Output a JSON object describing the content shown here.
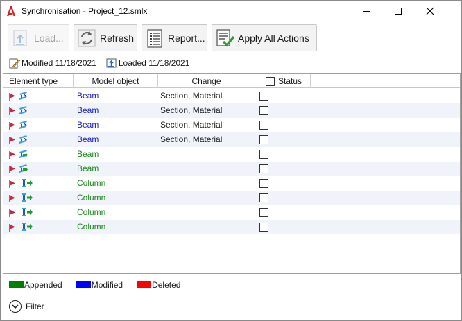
{
  "window": {
    "title": "Synchronisation - Project_12.smlx"
  },
  "toolbar": {
    "load_label": "Load...",
    "refresh_label": "Refresh",
    "report_label": "Report...",
    "apply_label": "Apply All Actions"
  },
  "info": {
    "modified": "Modified 11/18/2021",
    "loaded": "Loaded 11/18/2021"
  },
  "table": {
    "columns": [
      "Element type",
      "Model object",
      "Change",
      "Status"
    ],
    "rows": [
      {
        "element_icon": "beam-modified-icon",
        "object": "Beam",
        "change": "Section, Material",
        "status": false,
        "state": "modified"
      },
      {
        "element_icon": "beam-modified-icon",
        "object": "Beam",
        "change": "Section, Material",
        "status": false,
        "state": "modified"
      },
      {
        "element_icon": "beam-modified-icon",
        "object": "Beam",
        "change": "Section, Material",
        "status": false,
        "state": "modified"
      },
      {
        "element_icon": "beam-modified-icon",
        "object": "Beam",
        "change": "Section, Material",
        "status": false,
        "state": "modified"
      },
      {
        "element_icon": "beam-appended-icon",
        "object": "Beam",
        "change": "",
        "status": false,
        "state": "appended"
      },
      {
        "element_icon": "beam-appended-icon",
        "object": "Beam",
        "change": "",
        "status": false,
        "state": "appended"
      },
      {
        "element_icon": "column-appended-icon",
        "object": "Column",
        "change": "",
        "status": false,
        "state": "appended"
      },
      {
        "element_icon": "column-appended-icon",
        "object": "Column",
        "change": "",
        "status": false,
        "state": "appended"
      },
      {
        "element_icon": "column-appended-icon",
        "object": "Column",
        "change": "",
        "status": false,
        "state": "appended"
      },
      {
        "element_icon": "column-appended-icon",
        "object": "Column",
        "change": "",
        "status": false,
        "state": "appended"
      }
    ]
  },
  "legend": [
    {
      "label": "Appended",
      "color": "#008000"
    },
    {
      "label": "Modified",
      "color": "#0000ff"
    },
    {
      "label": "Deleted",
      "color": "#ff0000"
    }
  ],
  "filter": {
    "label": "Filter"
  },
  "colors": {
    "modified_text": "#1a22c8",
    "appended_text": "#1c8a1c"
  }
}
